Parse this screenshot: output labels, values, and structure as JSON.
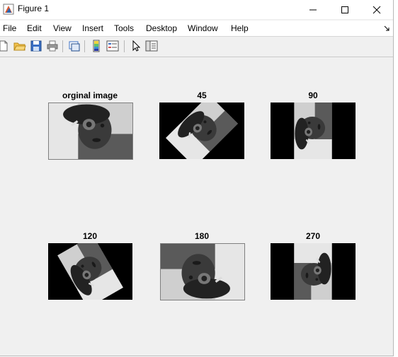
{
  "window": {
    "title": "Figure 1"
  },
  "menu": [
    "File",
    "Edit",
    "View",
    "Insert",
    "Tools",
    "Desktop",
    "Window",
    "Help"
  ],
  "toolbar": [
    "new-figure",
    "open-file",
    "save-figure",
    "print-figure",
    "link-plot",
    "insert-colorbar",
    "insert-legend",
    "edit-plot",
    "property-editor"
  ],
  "subplots": [
    {
      "title": "orginal image",
      "angle": 0
    },
    {
      "title": "45",
      "angle": 45
    },
    {
      "title": "90",
      "angle": 90
    },
    {
      "title": "120",
      "angle": 120
    },
    {
      "title": "180",
      "angle": 180
    },
    {
      "title": "270",
      "angle": 270
    }
  ],
  "colors": {
    "background": "#f0f0f0",
    "image_pad": "#000000"
  }
}
